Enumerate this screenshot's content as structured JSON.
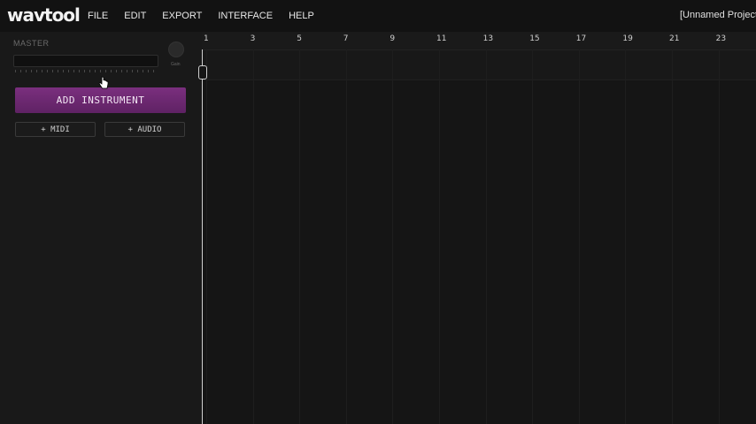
{
  "app": {
    "logo": "wavtool",
    "project_title": "[Unnamed Project"
  },
  "menu": {
    "items": [
      "FILE",
      "EDIT",
      "EXPORT",
      "INTERFACE",
      "HELP"
    ]
  },
  "master": {
    "label": "MASTER",
    "gain_label": "Gain",
    "fader_level": 0
  },
  "actions": {
    "add_instrument": "ADD INSTRUMENT",
    "add_midi": "+ MIDI",
    "add_audio": "+ AUDIO"
  },
  "timeline": {
    "ruler_labels": [
      "1",
      "3",
      "5",
      "7",
      "9",
      "11",
      "13",
      "15",
      "17",
      "19",
      "21",
      "23"
    ]
  },
  "colors": {
    "accent": "#7a2f7e",
    "background": "#141414"
  },
  "icons": {
    "cursor": "pointer-hand-icon",
    "knob": "gain-knob-icon"
  }
}
